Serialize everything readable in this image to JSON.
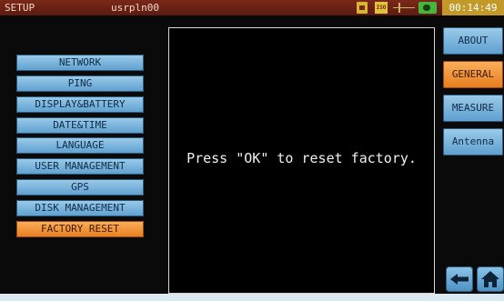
{
  "status_bar": {
    "mode": "SETUP",
    "user": "usrpln00",
    "icons": [
      "sd-card-icon",
      "iso-badge-icon",
      "antenna-icon",
      "battery-icon"
    ],
    "iso_label": "ISO",
    "time": "00:14:49"
  },
  "menu": {
    "items": [
      {
        "label": "NETWORK"
      },
      {
        "label": "PING"
      },
      {
        "label": "DISPLAY&BATTERY"
      },
      {
        "label": "DATE&TIME"
      },
      {
        "label": "LANGUAGE"
      },
      {
        "label": "USER MANAGEMENT"
      },
      {
        "label": "GPS"
      },
      {
        "label": "DISK MANAGEMENT"
      },
      {
        "label": "FACTORY RESET"
      }
    ],
    "selected": "FACTORY RESET"
  },
  "panel": {
    "message": "Press \"OK\" to reset factory."
  },
  "tabs": {
    "items": [
      {
        "label": "ABOUT"
      },
      {
        "label": "GENERAL"
      },
      {
        "label": "MEASURE"
      },
      {
        "label": "Antenna"
      }
    ],
    "selected": "GENERAL"
  },
  "nav": {
    "icons": [
      "back-arrow-icon",
      "home-icon"
    ]
  },
  "colors": {
    "status_bar": "#6b2214",
    "button_blue": "#7ab6de",
    "selected_orange": "#f39a3c",
    "clock_bg": "#c39a2a"
  }
}
